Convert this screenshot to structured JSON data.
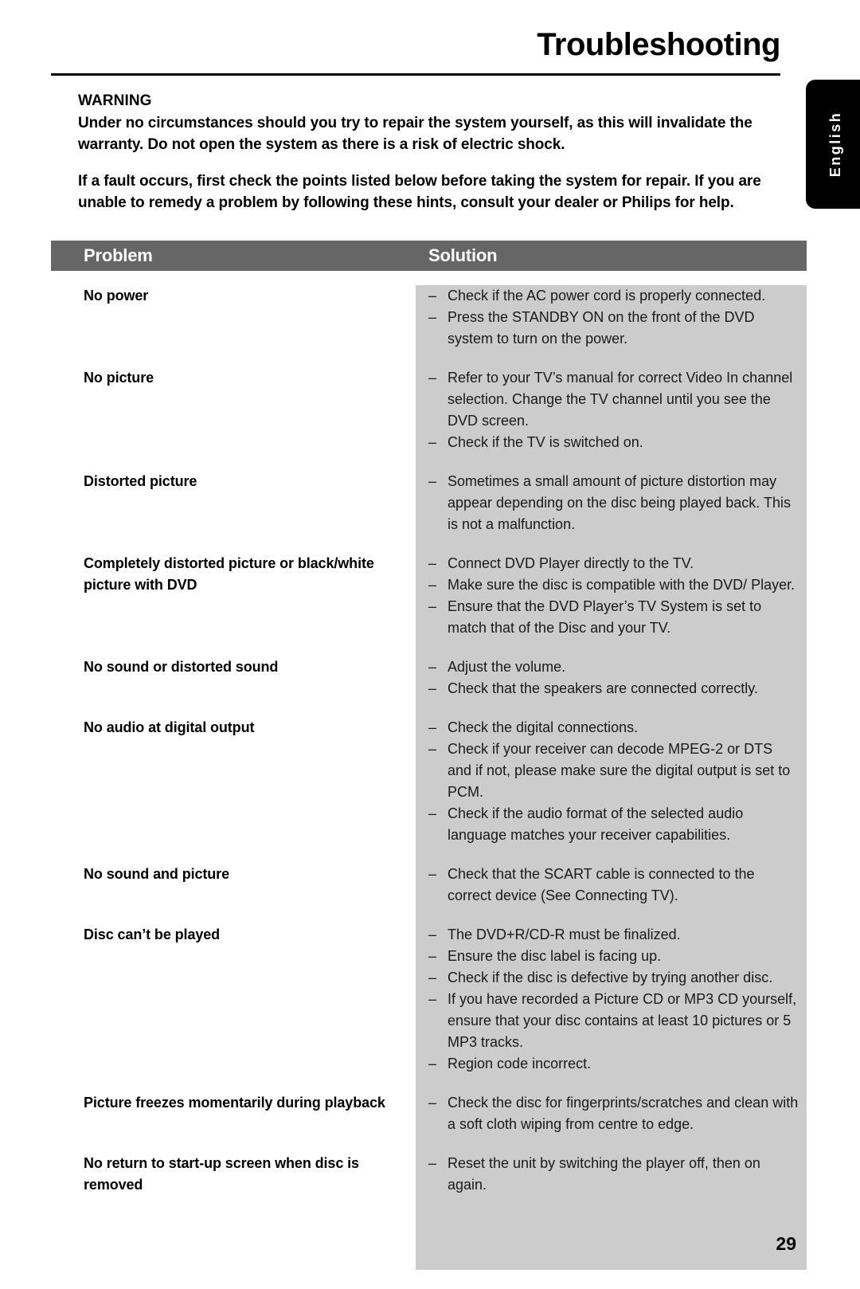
{
  "document": {
    "title": "Troubleshooting",
    "page_number": "29",
    "language_tab": "English"
  },
  "warning": {
    "heading": "WARNING",
    "paragraph_1": "Under no circumstances should you try to repair the system yourself, as this will invalidate the warranty.  Do not open the system as there is a risk of electric shock.",
    "paragraph_2": "If a fault occurs, first check the points listed below before taking the system for repair. If you are unable to remedy a problem by following these hints, consult your dealer or Philips for help."
  },
  "table": {
    "headers": {
      "problem": "Problem",
      "solution": "Solution"
    },
    "bullet_dash": "–",
    "rows": [
      {
        "problem": "No power",
        "solutions": [
          "Check if the AC power cord is properly connected.",
          "Press the STANDBY ON on the front of the DVD system to turn on the power."
        ]
      },
      {
        "problem": "No picture",
        "solutions": [
          "Refer to your TV’s manual for correct Video In channel selection.  Change the TV channel until you see the DVD screen.",
          "Check if the TV is switched on."
        ]
      },
      {
        "problem": "Distorted picture",
        "solutions": [
          "Sometimes a small amount of picture distortion may appear depending on the disc being played back. This is not a malfunction."
        ]
      },
      {
        "problem": "Completely distorted picture or black/white picture with DVD",
        "solutions": [
          "Connect DVD Player directly to the TV.",
          "Make sure the disc is compatible with the DVD/ Player.",
          "Ensure that the DVD Player’s TV System is set to match that of the Disc and your TV."
        ]
      },
      {
        "problem": "No sound or distorted sound",
        "solutions": [
          "Adjust the volume.",
          "Check that the speakers are connected correctly."
        ]
      },
      {
        "problem": "No audio at digital output",
        "solutions": [
          "Check the digital connections.",
          "Check if your receiver can decode MPEG-2 or DTS and if not, please make sure the digital output is set to PCM.",
          "Check if the audio format of the selected audio language matches your receiver capabilities."
        ]
      },
      {
        "problem": "No sound and picture",
        "solutions": [
          "Check that the SCART cable is connected to the correct device (See Connecting TV)."
        ]
      },
      {
        "problem": "Disc can’t be played",
        "solutions": [
          "The DVD+R/CD-R must be finalized.",
          "Ensure the disc label is facing up.",
          "Check if the disc is defective by trying another disc.",
          "If you have recorded a Picture CD or MP3 CD yourself, ensure that your disc contains at least 10 pictures or 5 MP3 tracks.",
          "Region code incorrect."
        ]
      },
      {
        "problem": "Picture freezes momentarily during playback",
        "solutions": [
          "Check the disc for fingerprints/scratches and clean with a soft cloth wiping from centre to edge."
        ]
      },
      {
        "problem": "No return to start-up screen when disc is removed",
        "solutions": [
          "Reset the unit by switching the player off, then on again."
        ]
      }
    ]
  }
}
